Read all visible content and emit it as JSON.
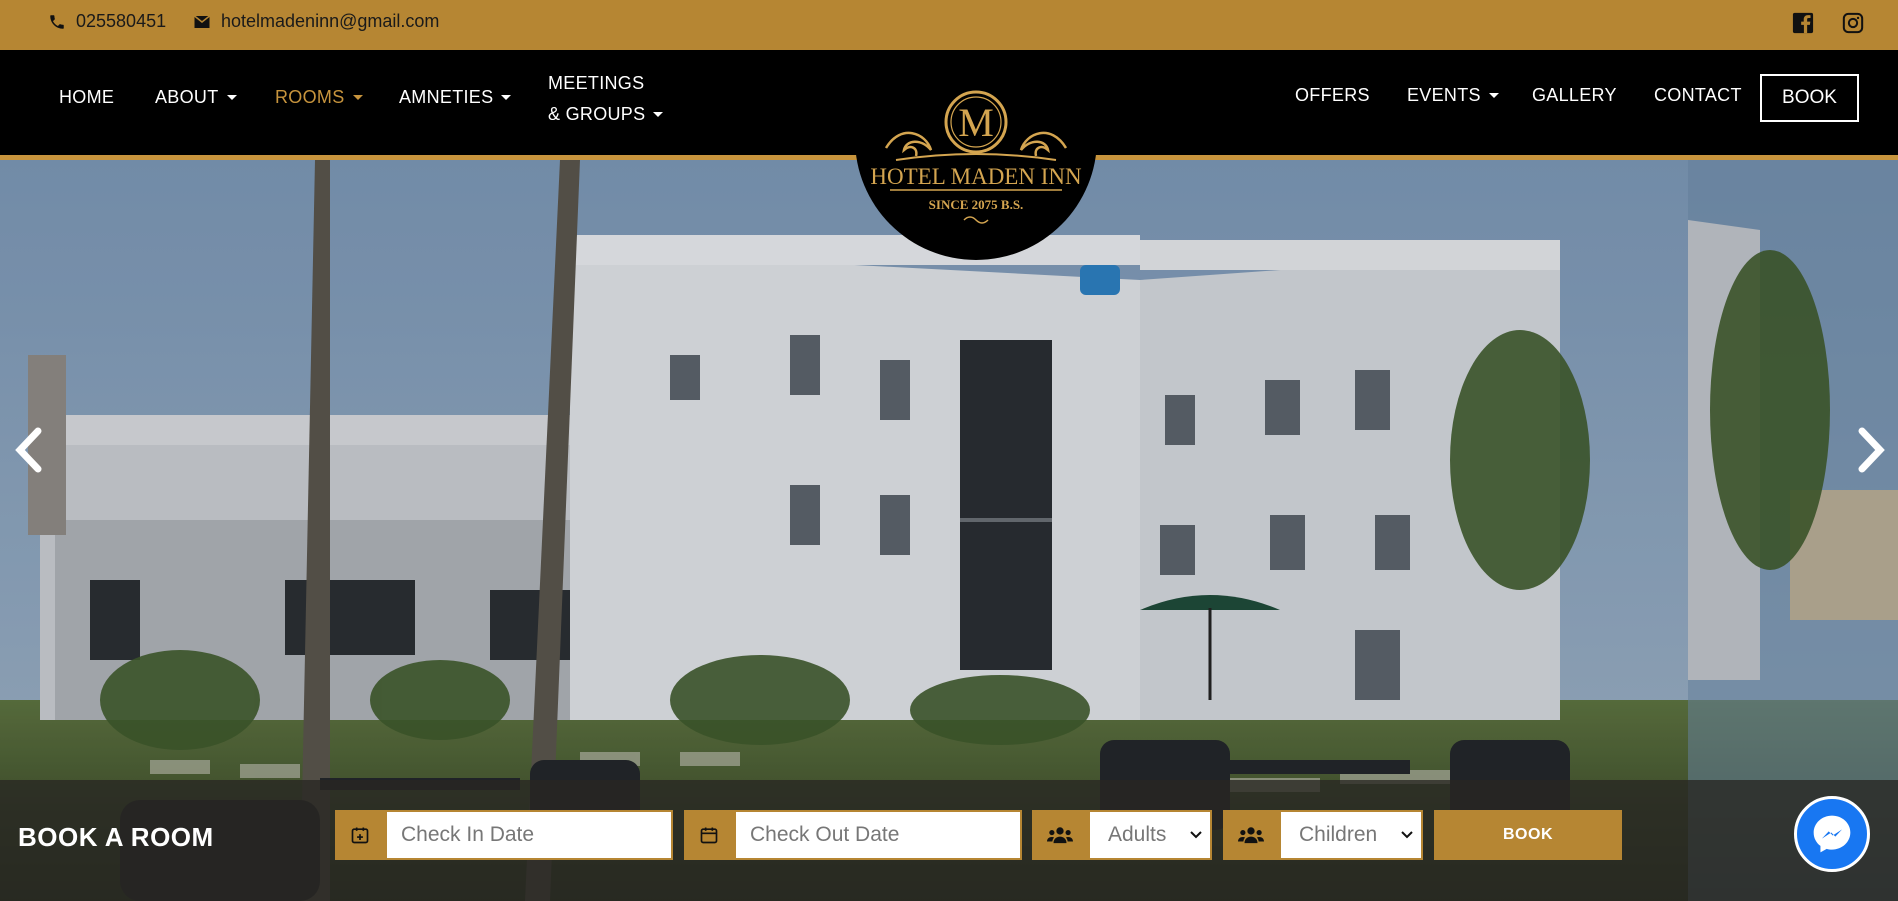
{
  "topbar": {
    "phone": "025580451",
    "email": "hotelmadeninn@gmail.com",
    "social": [
      "facebook-icon",
      "instagram-icon"
    ]
  },
  "nav": {
    "left": [
      {
        "label": "HOME"
      },
      {
        "label": "ABOUT"
      },
      {
        "label": "ROOMS"
      },
      {
        "label": "AMNETIES"
      }
    ],
    "meetings_line1": "MEETINGS",
    "meetings_line2": "& GROUPS",
    "right": [
      {
        "label": "OFFERS"
      },
      {
        "label": "EVENTS"
      },
      {
        "label": "GALLERY"
      },
      {
        "label": "CONTACT"
      }
    ],
    "book": "BOOK"
  },
  "logo": {
    "initial": "M",
    "name": "HOTEL MADEN INN",
    "since": "SINCE 2075 B.S."
  },
  "booking": {
    "title": "BOOK A ROOM",
    "checkin_placeholder": "Check In Date",
    "checkout_placeholder": "Check Out Date",
    "adults": "Adults",
    "children": "Children",
    "submit": "BOOK"
  },
  "colors": {
    "gold": "#b68633",
    "accent": "#c7943d",
    "messenger": "#1877f2"
  }
}
